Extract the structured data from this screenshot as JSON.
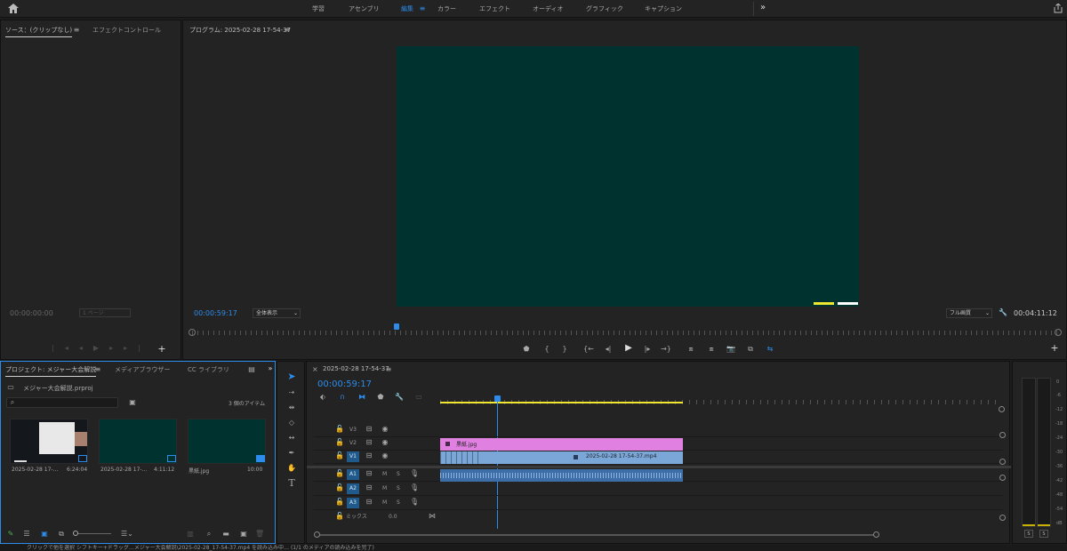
{
  "topbar": {
    "tabs": [
      "学習",
      "アセンブリ",
      "編集",
      "カラー",
      "エフェクト",
      "オーディオ",
      "グラフィック",
      "キャプション"
    ],
    "active_tab": "編集",
    "more": "»"
  },
  "source_panel": {
    "tab_source": "ソース：(クリップなし)",
    "tab_effect_controls": "エフェクトコントロール",
    "timecode": "00:00:00:00",
    "page_label": "1 ページ"
  },
  "program_panel": {
    "title": "プログラム: 2025-02-28 17-54-37",
    "timecode": "00:00:59:17",
    "zoom": "全体表示",
    "quality": "フル画質",
    "duration": "00:04:11:12",
    "preview_color": "#003330"
  },
  "project_panel": {
    "tab_project": "プロジェクト: メジャー大会解説",
    "tab_media_browser": "メディアブラウザー",
    "tab_cc": "CC ライブラリ",
    "file_name": "メジャー大会解説.prproj",
    "item_count": "3 個のアイテム",
    "items": [
      {
        "name": "2025-02-28 17-...",
        "duration": "6:24:04"
      },
      {
        "name": "2025-02-28 17-...",
        "duration": "4:11:12"
      },
      {
        "name": "黒紙.jpg",
        "duration": "10:00"
      }
    ]
  },
  "timeline": {
    "tab": "2025-02-28 17-54-37",
    "timecode": "00:00:59:17",
    "tracks_video": [
      "V3",
      "V2",
      "V1"
    ],
    "tracks_audio": [
      "A1",
      "A2",
      "A3"
    ],
    "mix_label": "ミックス",
    "mix_value": "0.0",
    "clip_v2": "黒紙.jpg",
    "clip_v1": "2025-02-28 17-54-37.mp4",
    "track_m": "M",
    "track_s": "S"
  },
  "meter": {
    "labels": [
      "0",
      "-6",
      "-12",
      "-18",
      "-24",
      "-30",
      "-36",
      "-42",
      "-48",
      "-54",
      "dB"
    ],
    "solo": "S"
  },
  "status_bar": {
    "text": "クリックで他を選択 シフトキー+ドラッグ…メジャー大会解説\\2025-02-28_17-54-37.mp4 を読み込み中… (1/1 のメディアの読み込みを完了)"
  },
  "colors": {
    "accent": "#2d8ceb",
    "clip_pink": "#e080e0",
    "clip_blue": "#7aa6d8",
    "yellow": "#f0e830"
  }
}
